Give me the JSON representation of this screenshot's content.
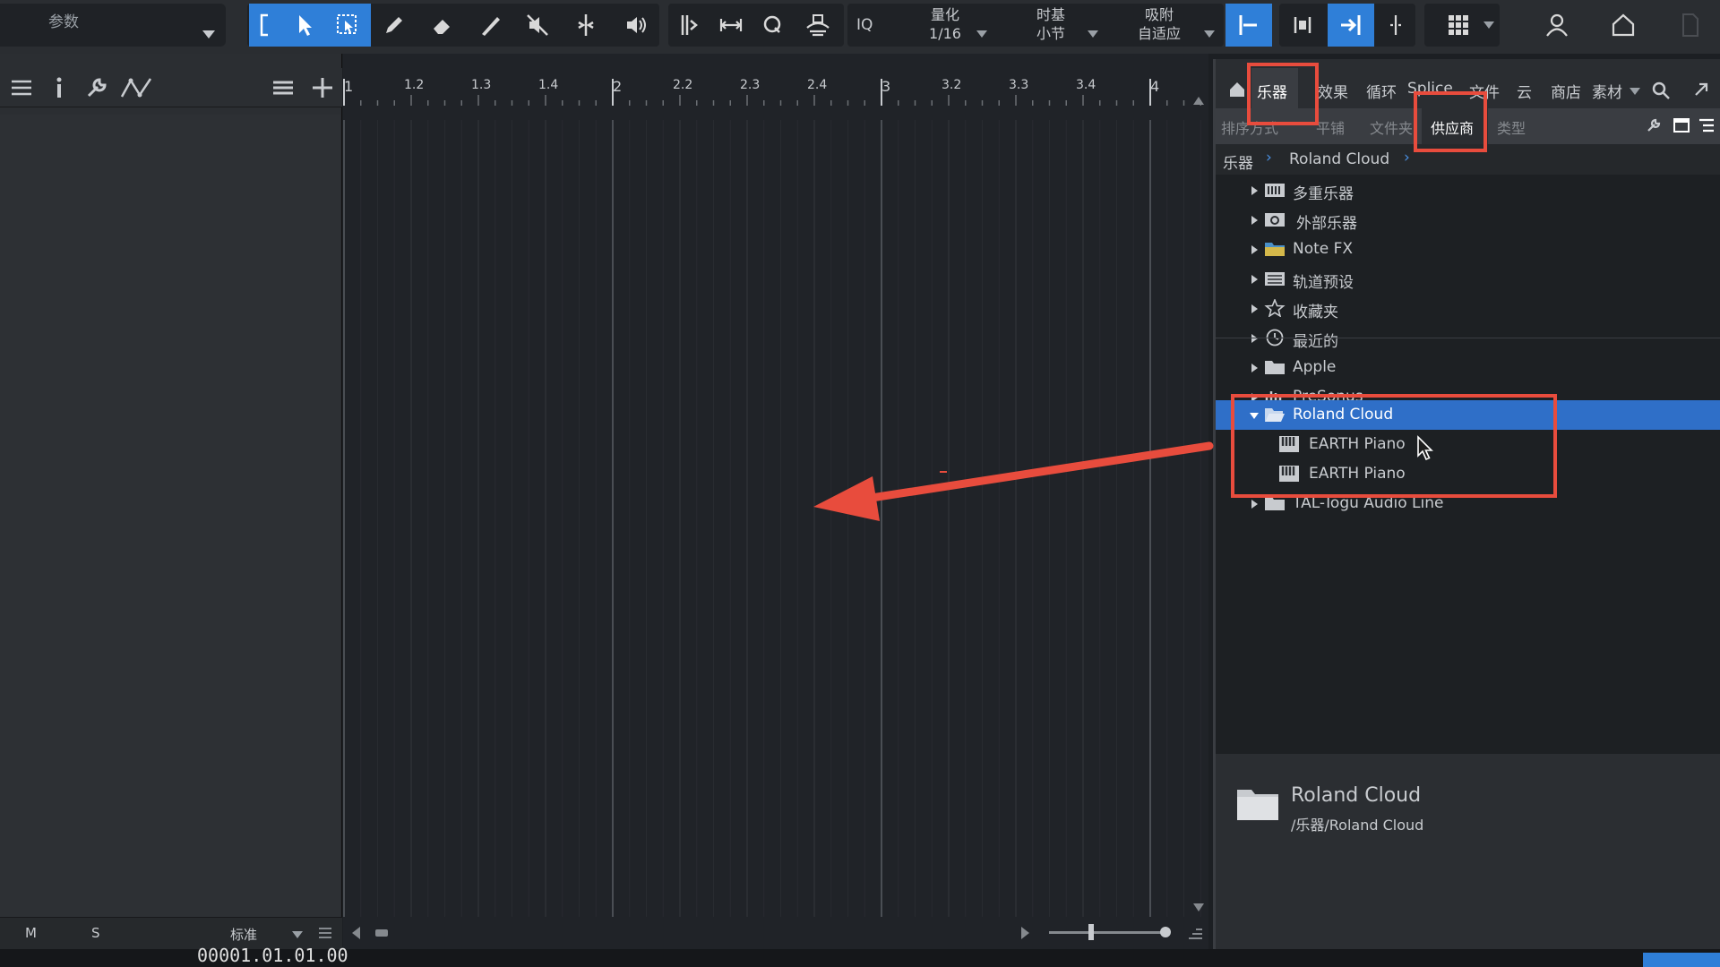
{
  "toolbar": {
    "params_label": "参数",
    "quantize_label": "量化",
    "quantize_value": "1/16",
    "timebase_label": "时基",
    "timebase_value": "小节",
    "snap_label": "吸附",
    "snap_value": "自适应",
    "iq_label": "IQ"
  },
  "inspector": {
    "mute_label": "M",
    "solo_label": "S",
    "mode_label": "标准"
  },
  "ruler": {
    "labels": [
      "1",
      "1.2",
      "1.3",
      "1.4",
      "2",
      "2.2",
      "2.3",
      "2.4",
      "3",
      "3.2",
      "3.3",
      "3.4",
      "4"
    ]
  },
  "browser": {
    "tabs": [
      "乐器",
      "效果",
      "循环",
      "Splice",
      "文件",
      "云",
      "商店",
      "素材"
    ],
    "subtabs": [
      "排序方式",
      "平铺",
      "文件夹",
      "供应商",
      "类型"
    ],
    "breadcrumb": [
      "乐器",
      "Roland Cloud"
    ],
    "tree": [
      {
        "label": "多重乐器",
        "icon": "multi-instrument-icon"
      },
      {
        "label": "外部乐器",
        "icon": "external-instrument-icon"
      },
      {
        "label": "Note FX",
        "icon": "note-fx-folder-icon"
      },
      {
        "label": "轨道预设",
        "icon": "track-preset-icon"
      },
      {
        "label": "收藏夹",
        "icon": "star-icon"
      },
      {
        "label": "最近的",
        "icon": "clock-icon"
      },
      {
        "label": "Apple",
        "icon": "folder-icon"
      },
      {
        "label": "PreSonus",
        "icon": "presonus-icon"
      },
      {
        "label": "Roland Cloud",
        "icon": "folder-open-icon"
      },
      {
        "label": "EARTH Piano",
        "icon": "piano-vst-icon"
      },
      {
        "label": "EARTH Piano",
        "icon": "piano-au-icon"
      },
      {
        "label": "TAL-Togu Audio Line",
        "icon": "folder-icon"
      }
    ],
    "info_title": "Roland Cloud",
    "info_path": "/乐器/Roland Cloud"
  },
  "transport": {
    "time": "00001.01.01.00"
  },
  "colors": {
    "accent": "#2f7fd8",
    "selection": "#2f6fc8",
    "annotation": "#e84c3d"
  }
}
